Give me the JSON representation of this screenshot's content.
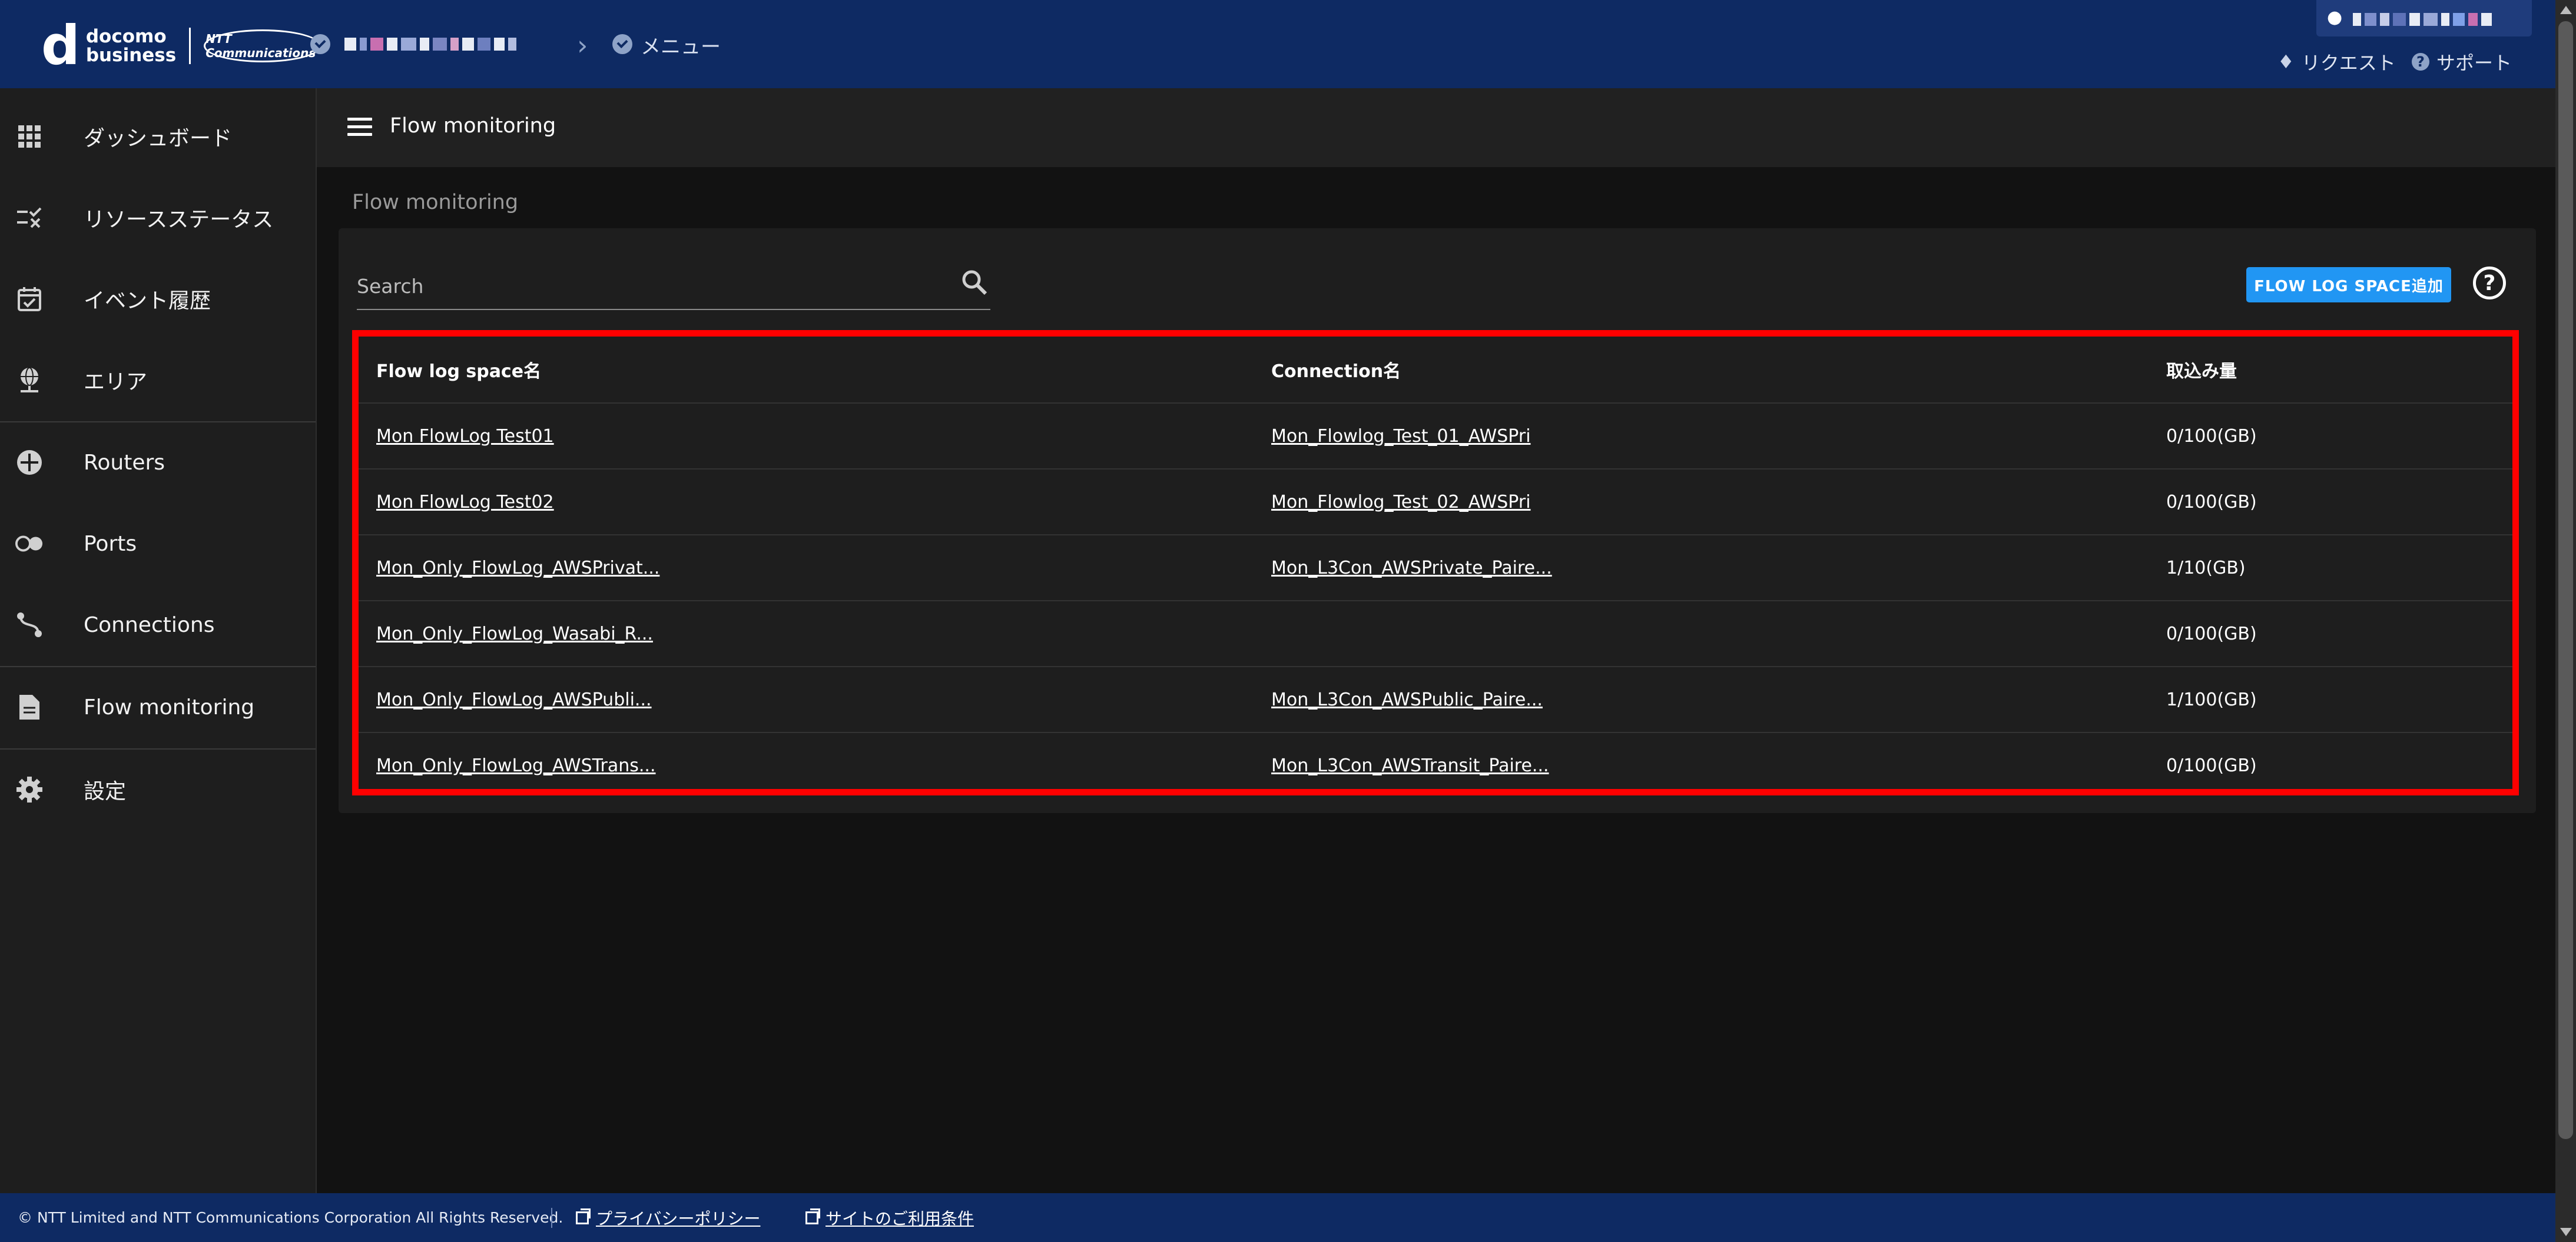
{
  "header": {
    "logo_mark": "d",
    "logo_line1": "docomo",
    "logo_line2": "business",
    "partner_logo": "NTT Communications",
    "breadcrumb_menu": "メニュー",
    "request_label": "リクエスト",
    "support_label": "サポート"
  },
  "sidebar": {
    "items": [
      {
        "label": "ダッシュボード",
        "icon": "dashboard-grid-icon"
      },
      {
        "label": "リソースステータス",
        "icon": "resource-status-icon"
      },
      {
        "label": "イベント履歴",
        "icon": "calendar-check-icon"
      },
      {
        "label": "エリア",
        "icon": "globe-pin-icon"
      },
      {
        "label": "Routers",
        "icon": "router-icon"
      },
      {
        "label": "Ports",
        "icon": "ports-icon"
      },
      {
        "label": "Connections",
        "icon": "connections-icon"
      },
      {
        "label": "Flow monitoring",
        "icon": "document-icon"
      },
      {
        "label": "設定",
        "icon": "gear-icon"
      }
    ]
  },
  "topbar": {
    "title": "Flow monitoring"
  },
  "page": {
    "section_title": "Flow monitoring"
  },
  "search": {
    "placeholder": "Search"
  },
  "actions": {
    "add_label": "FLOW LOG SPACE追加"
  },
  "table": {
    "columns": [
      "Flow log space名",
      "Connection名",
      "取込み量"
    ],
    "rows": [
      {
        "space": "Mon FlowLog Test01",
        "connection": "Mon_Flowlog_Test_01_AWSPri",
        "volume": "0/100(GB)"
      },
      {
        "space": "Mon FlowLog Test02",
        "connection": "Mon_Flowlog_Test_02_AWSPri",
        "volume": "0/100(GB)"
      },
      {
        "space": "Mon_Only_FlowLog_AWSPrivat...",
        "connection": "Mon_L3Con_AWSPrivate_Paire...",
        "volume": "1/10(GB)"
      },
      {
        "space": "Mon_Only_FlowLog_Wasabi_R...",
        "connection": "",
        "volume": "0/100(GB)"
      },
      {
        "space": "Mon_Only_FlowLog_AWSPubli...",
        "connection": "Mon_L3Con_AWSPublic_Paire...",
        "volume": "1/100(GB)"
      },
      {
        "space": "Mon_Only_FlowLog_AWSTrans...",
        "connection": "Mon_L3Con_AWSTransit_Paire...",
        "volume": "0/100(GB)"
      }
    ]
  },
  "footer": {
    "copyright": "© NTT Limited and NTT Communications Corporation All Rights Reserved.",
    "privacy_label": "プライバシーポリシー",
    "terms_label": "サイトのご利用条件"
  },
  "colors": {
    "header_bg": "#0e2a63",
    "accent": "#2196f3",
    "highlight_border": "#ff0000"
  }
}
